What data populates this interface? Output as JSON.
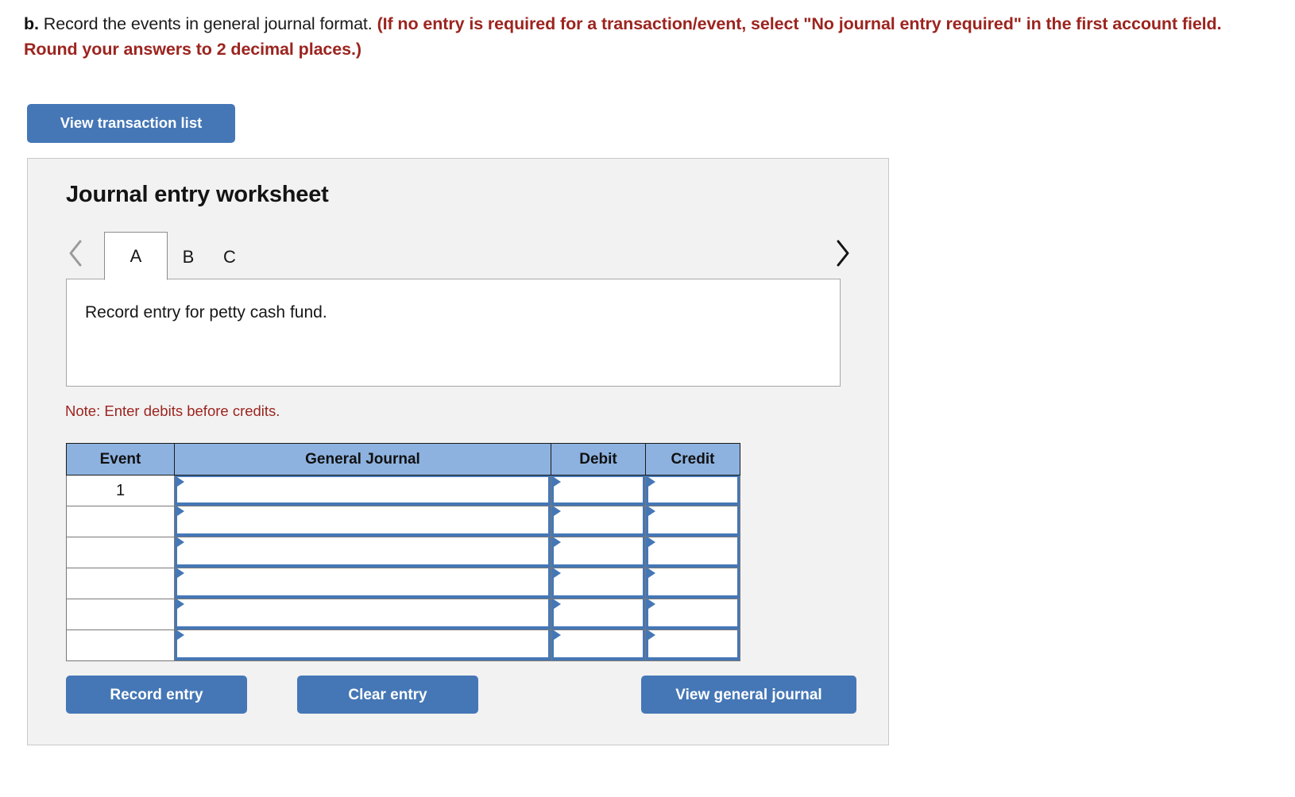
{
  "prompt": {
    "label": "b.",
    "plain_text": " Record the events in general journal format. ",
    "red_text": "(If no entry is required for a transaction/event, select \"No journal entry required\" in the first account field. Round your answers to 2 decimal places.)"
  },
  "view_transaction_list_button": "View transaction list",
  "worksheet": {
    "title": "Journal entry worksheet",
    "prev_icon": "chevron-left-icon",
    "next_icon": "chevron-right-icon",
    "tabs": [
      {
        "label": "A",
        "active": true
      },
      {
        "label": "B",
        "active": false
      },
      {
        "label": "C",
        "active": false
      }
    ],
    "description": "Record entry for petty cash fund.",
    "note": "Note: Enter debits before credits.",
    "table": {
      "headers": [
        "Event",
        "General Journal",
        "Debit",
        "Credit"
      ],
      "rows": [
        {
          "event": "1",
          "general_journal": "",
          "debit": "",
          "credit": ""
        },
        {
          "event": "",
          "general_journal": "",
          "debit": "",
          "credit": ""
        },
        {
          "event": "",
          "general_journal": "",
          "debit": "",
          "credit": ""
        },
        {
          "event": "",
          "general_journal": "",
          "debit": "",
          "credit": ""
        },
        {
          "event": "",
          "general_journal": "",
          "debit": "",
          "credit": ""
        },
        {
          "event": "",
          "general_journal": "",
          "debit": "",
          "credit": ""
        }
      ]
    },
    "buttons": {
      "record_entry": "Record entry",
      "clear_entry": "Clear entry",
      "view_general_journal": "View general journal"
    }
  },
  "colors": {
    "button_blue": "#4577b6",
    "header_blue": "#8db2e0",
    "red_text": "#9c241f",
    "panel_gray": "#f2f2f2",
    "panel_border": "#c8c8c8"
  }
}
